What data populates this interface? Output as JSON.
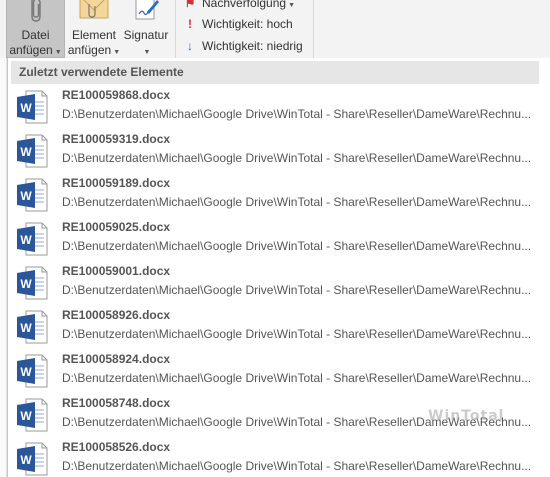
{
  "ribbon": {
    "attach_file": {
      "line1": "Datei",
      "line2": "anfügen",
      "icon": "paperclip-icon"
    },
    "attach_item": {
      "line1": "Element",
      "line2": "anfügen",
      "icon": "envelope-icon"
    },
    "signature": {
      "line1": "Signatur",
      "icon": "signature-icon"
    },
    "follow_up": {
      "label": "Nachverfolgung",
      "icon": "flag-icon"
    },
    "high_importance": {
      "label": "Wichtigkeit: hoch",
      "icon": "exclamation-icon"
    },
    "low_importance": {
      "label": "Wichtigkeit: niedrig",
      "icon": "down-arrow-icon"
    }
  },
  "dropdown": {
    "header": "Zuletzt verwendete Elemente",
    "items": [
      {
        "name": "RE100059868.docx",
        "path": "D:\\Benutzerdaten\\Michael\\Google Drive\\WinTotal - Share\\Reseller\\DameWare\\Rechnu..."
      },
      {
        "name": "RE100059319.docx",
        "path": "D:\\Benutzerdaten\\Michael\\Google Drive\\WinTotal - Share\\Reseller\\DameWare\\Rechnu..."
      },
      {
        "name": "RE100059189.docx",
        "path": "D:\\Benutzerdaten\\Michael\\Google Drive\\WinTotal - Share\\Reseller\\DameWare\\Rechnu..."
      },
      {
        "name": "RE100059025.docx",
        "path": "D:\\Benutzerdaten\\Michael\\Google Drive\\WinTotal - Share\\Reseller\\DameWare\\Rechnu..."
      },
      {
        "name": "RE100059001.docx",
        "path": "D:\\Benutzerdaten\\Michael\\Google Drive\\WinTotal - Share\\Reseller\\DameWare\\Rechnu..."
      },
      {
        "name": "RE100058926.docx",
        "path": "D:\\Benutzerdaten\\Michael\\Google Drive\\WinTotal - Share\\Reseller\\DameWare\\Rechnu..."
      },
      {
        "name": "RE100058924.docx",
        "path": "D:\\Benutzerdaten\\Michael\\Google Drive\\WinTotal - Share\\Reseller\\DameWare\\Rechnu..."
      },
      {
        "name": "RE100058748.docx",
        "path": "D:\\Benutzerdaten\\Michael\\Google Drive\\WinTotal - Share\\Reseller\\DameWare\\Rechnu..."
      },
      {
        "name": "RE100058526.docx",
        "path": "D:\\Benutzerdaten\\Michael\\Google Drive\\WinTotal - Share\\Reseller\\DameWare\\Rechnu..."
      }
    ]
  },
  "watermark": "WinTotal",
  "colors": {
    "word_blue": "#2b579a",
    "flag_red": "#d13438",
    "arrow_blue": "#2b6cc4",
    "selected_button": "#c5c5c5"
  }
}
